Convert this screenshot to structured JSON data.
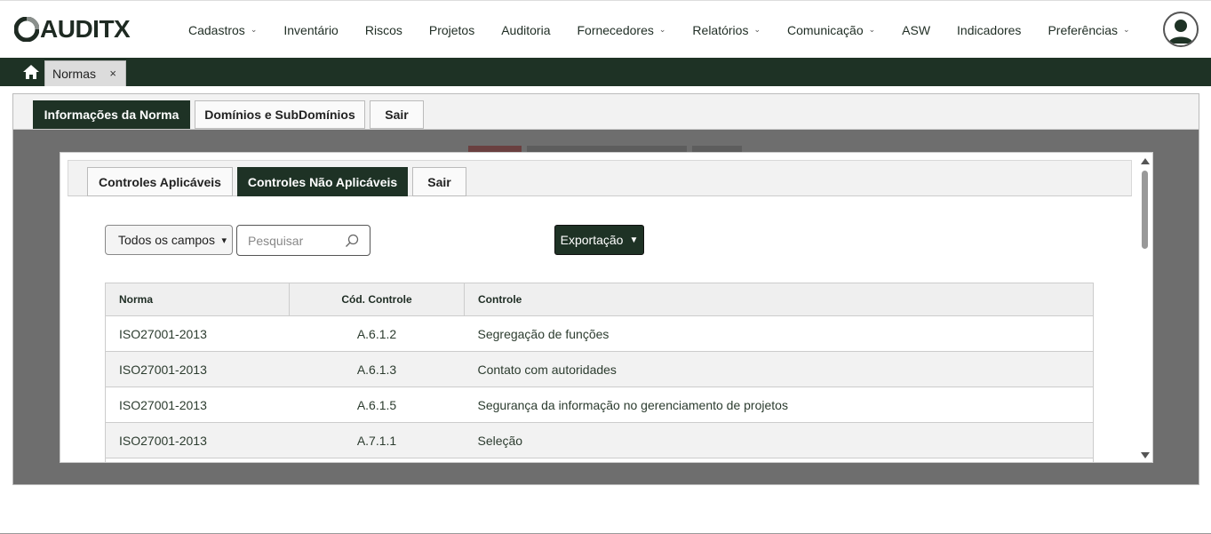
{
  "app": {
    "logo_text": "AUDITX"
  },
  "nav": {
    "items": [
      {
        "label": "Cadastros",
        "has_caret": true
      },
      {
        "label": "Inventário",
        "has_caret": false
      },
      {
        "label": "Riscos",
        "has_caret": false
      },
      {
        "label": "Projetos",
        "has_caret": false
      },
      {
        "label": "Auditoria",
        "has_caret": false
      },
      {
        "label": "Fornecedores",
        "has_caret": true
      },
      {
        "label": "Relatórios",
        "has_caret": true
      },
      {
        "label": "Comunicação",
        "has_caret": true
      },
      {
        "label": "ASW",
        "has_caret": false
      },
      {
        "label": "Indicadores",
        "has_caret": false
      },
      {
        "label": "Preferências",
        "has_caret": true
      }
    ],
    "caret_glyph": "⌄"
  },
  "doc_tabs": {
    "active": "Normas",
    "close": "×"
  },
  "outer_tabs": [
    {
      "label": "Informações da Norma",
      "active": true
    },
    {
      "label": "Domínios e SubDomínios",
      "active": false
    },
    {
      "label": "Sair",
      "active": false
    }
  ],
  "modal": {
    "tabs": [
      {
        "label": "Controles Aplicáveis",
        "active": false
      },
      {
        "label": "Controles Não Aplicáveis",
        "active": true
      },
      {
        "label": "Sair",
        "active": false
      }
    ],
    "filter_select": "Todos os campos",
    "search_placeholder": "Pesquisar",
    "export_label": "Exportação",
    "table": {
      "headers": [
        "Norma",
        "Cód. Controle",
        "Controle"
      ],
      "rows": [
        [
          "ISO27001-2013",
          "A.6.1.2",
          "Segregação de funções"
        ],
        [
          "ISO27001-2013",
          "A.6.1.3",
          "Contato com autoridades"
        ],
        [
          "ISO27001-2013",
          "A.6.1.5",
          "Segurança da informação no gerenciamento de projetos"
        ],
        [
          "ISO27001-2013",
          "A.7.1.1",
          "Seleção"
        ]
      ]
    }
  },
  "colors": {
    "brand_dark": "#1e3225",
    "text_green": "#2c3c2f"
  }
}
